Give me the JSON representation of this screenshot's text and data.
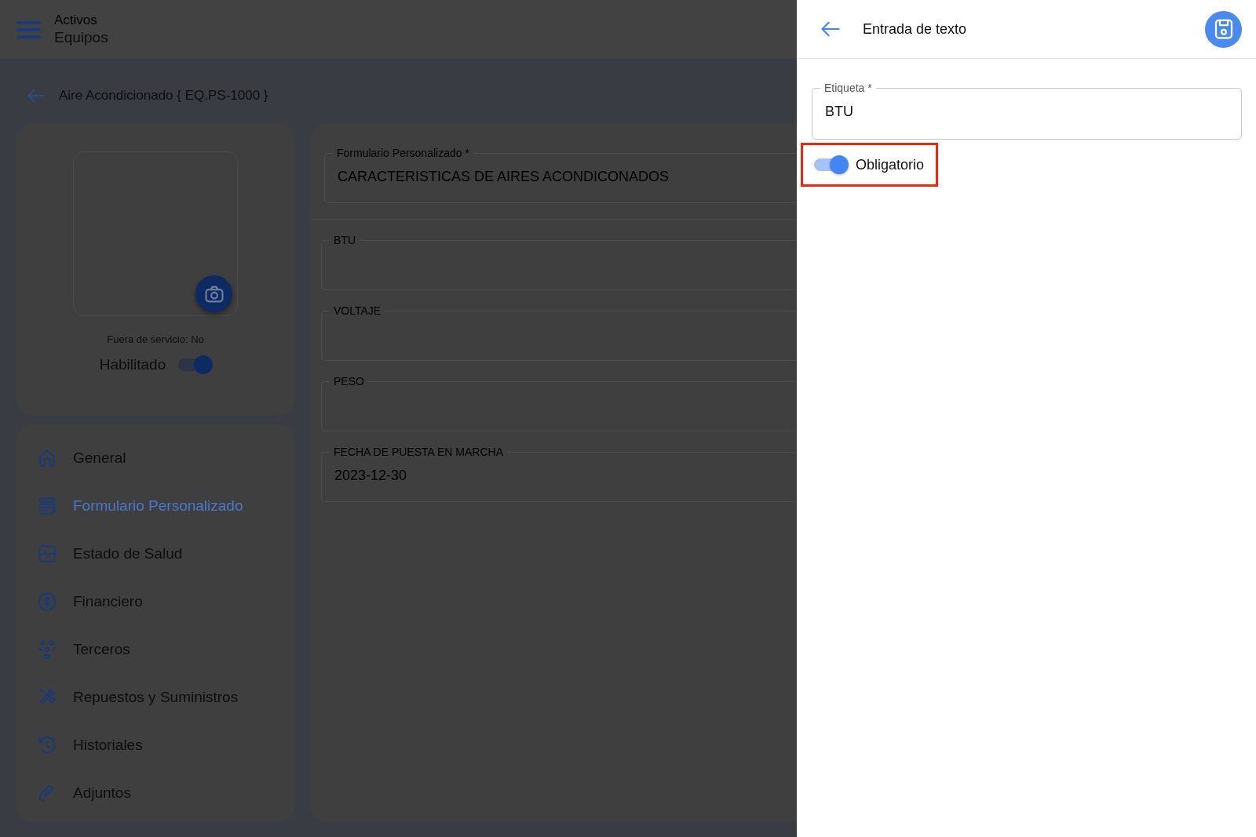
{
  "app_bar": {
    "section": "Activos",
    "title": "Equipos"
  },
  "page": {
    "title": "Aire Acondicionado { EQ.PS-1000 }"
  },
  "asset_card": {
    "status": "Fuera de servicio: No",
    "enabled_label": "Habilitado",
    "enabled": true
  },
  "nav": [
    {
      "label": "General",
      "selected": false
    },
    {
      "label": "Formulario Personalizado",
      "selected": true
    },
    {
      "label": "Estado de Salud",
      "selected": false
    },
    {
      "label": "Financiero",
      "selected": false
    },
    {
      "label": "Terceros",
      "selected": false
    },
    {
      "label": "Repuestos y Suministros",
      "selected": false
    },
    {
      "label": "Historiales",
      "selected": false
    },
    {
      "label": "Adjuntos",
      "selected": false
    }
  ],
  "form": {
    "template": {
      "label": "Formulario Personalizado *",
      "value": "CARACTERISTICAS DE AIRES ACONDICONADOS"
    },
    "fields": [
      {
        "label": "BTU"
      },
      {
        "label": "VOLTAJE"
      },
      {
        "label": "PESO"
      },
      {
        "label": "FECHA DE PUESTA EN MARCHA",
        "value": "2023-12-30"
      }
    ]
  },
  "drawer": {
    "title": "Entrada de texto",
    "field": {
      "label": "Etiqueta *",
      "value": "BTU"
    },
    "required_label": "Obligatorio",
    "required": true,
    "highlighted": true
  }
}
